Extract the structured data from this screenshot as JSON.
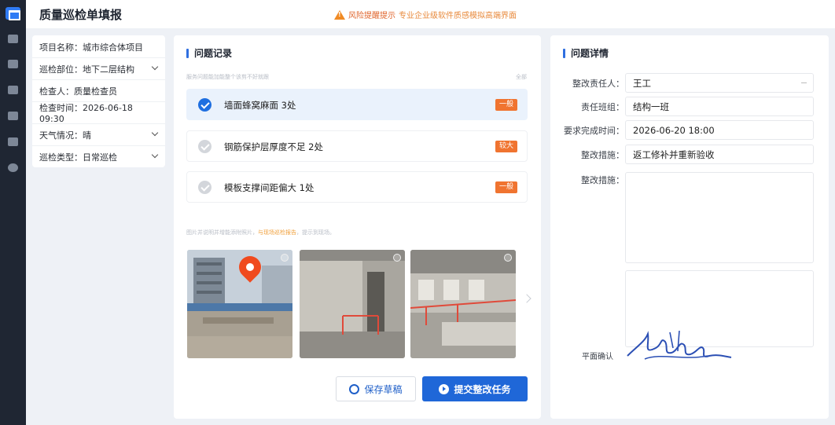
{
  "app": {
    "title": "质量巡检单填报"
  },
  "notice": {
    "line1": "风险提醒提示",
    "line2": "专业企业级软件质感模拟高端界面"
  },
  "colors": {
    "accent": "#1f67d8",
    "tag": "#f07430",
    "rail": "#1f2633",
    "warn": "#f08a24"
  },
  "sidebar_icons": [
    "app-logo-icon",
    "home-icon",
    "calendar-icon",
    "building-icon",
    "grid-icon",
    "calendar-check-icon",
    "settings-icon"
  ],
  "info": {
    "project": "项目名称：城市综合体项目",
    "location": "巡检部位：地下二层结构",
    "inspector": "检查人：质量检查员",
    "time": "检查时间：2026-06-18 09:30",
    "weather": "天气情况：晴",
    "type": "巡检类型：日常巡检"
  },
  "records": {
    "title": "问题记录",
    "hint": "服务问题能加能整个该剪不好就跟",
    "filter": "全部",
    "items": [
      {
        "text": "墙面蜂窝麻面 3处",
        "tag": "一般",
        "selected": true
      },
      {
        "text": "钢筋保护层厚度不足 2处",
        "tag": "较大",
        "selected": false
      },
      {
        "text": "模板支撑间距偏大 1处",
        "tag": "一般",
        "selected": false
      }
    ],
    "photo_hint_a": "图片并说明并增能添附照片，",
    "photo_hint_b": "与现场巡检报告",
    "photo_hint_c": "，提示到现场。"
  },
  "actions": {
    "save": "保存草稿",
    "submit": "提交整改任务"
  },
  "detail": {
    "title": "问题详情",
    "owner_label": "整改责任人：",
    "owner": "王工",
    "team_label": "责任班组：",
    "team": "结构一班",
    "due_label": "要求完成时间：",
    "due": "2026-06-20 18:00",
    "measure_label": "整改措施：",
    "measure": "返工修补并重新验收",
    "measure2_label": "整改措施：",
    "sign_label": "平面确认"
  }
}
